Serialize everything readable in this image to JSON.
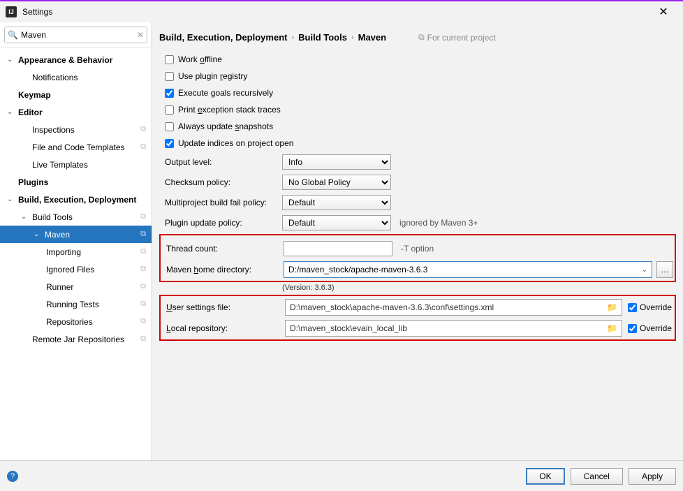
{
  "window": {
    "title": "Settings",
    "close": "✕"
  },
  "search": {
    "value": "Maven",
    "clear": "✕"
  },
  "tree": {
    "appearance": "Appearance & Behavior",
    "notifications": "Notifications",
    "keymap": "Keymap",
    "editor": "Editor",
    "inspections": "Inspections",
    "file_templates": "File and Code Templates",
    "live_templates": "Live Templates",
    "plugins": "Plugins",
    "bed": "Build, Execution, Deployment",
    "build_tools": "Build Tools",
    "maven": "Maven",
    "importing": "Importing",
    "ignored": "Ignored Files",
    "runner": "Runner",
    "running_tests": "Running Tests",
    "repositories": "Repositories",
    "remote": "Remote Jar Repositories"
  },
  "breadcrumbs": {
    "a": "Build, Execution, Deployment",
    "b": "Build Tools",
    "c": "Maven",
    "proj": "For current project"
  },
  "checks": {
    "work_offline": "Work offline",
    "use_plugin": "Use plugin registry",
    "execute_goals": "Execute goals recursively",
    "print_exc": "Print exception stack traces",
    "always_update": "Always update snapshots",
    "update_indices": "Update indices on project open"
  },
  "fields": {
    "output_level": {
      "label": "Output level:",
      "value": "Info"
    },
    "checksum": {
      "label": "Checksum policy:",
      "value": "No Global Policy"
    },
    "multi": {
      "label": "Multiproject build fail policy:",
      "value": "Default"
    },
    "plugin_update": {
      "label": "Plugin update policy:",
      "value": "Default",
      "suffix": "ignored by Maven 3+"
    },
    "thread": {
      "label": "Thread count:",
      "value": "",
      "suffix": "-T option"
    },
    "home": {
      "label": "Maven home directory:",
      "value": "D:/maven_stock/apache-maven-3.6.3"
    },
    "version": "(Version: 3.6.3)",
    "user_settings": {
      "label": "User settings file:",
      "value": "D:\\maven_stock\\apache-maven-3.6.3\\conf\\settings.xml"
    },
    "local_repo": {
      "label": "Local repository:",
      "value": "D:\\maven_stock\\evain_local_lib"
    },
    "override": "Override"
  },
  "buttons": {
    "ok": "OK",
    "cancel": "Cancel",
    "apply": "Apply"
  }
}
